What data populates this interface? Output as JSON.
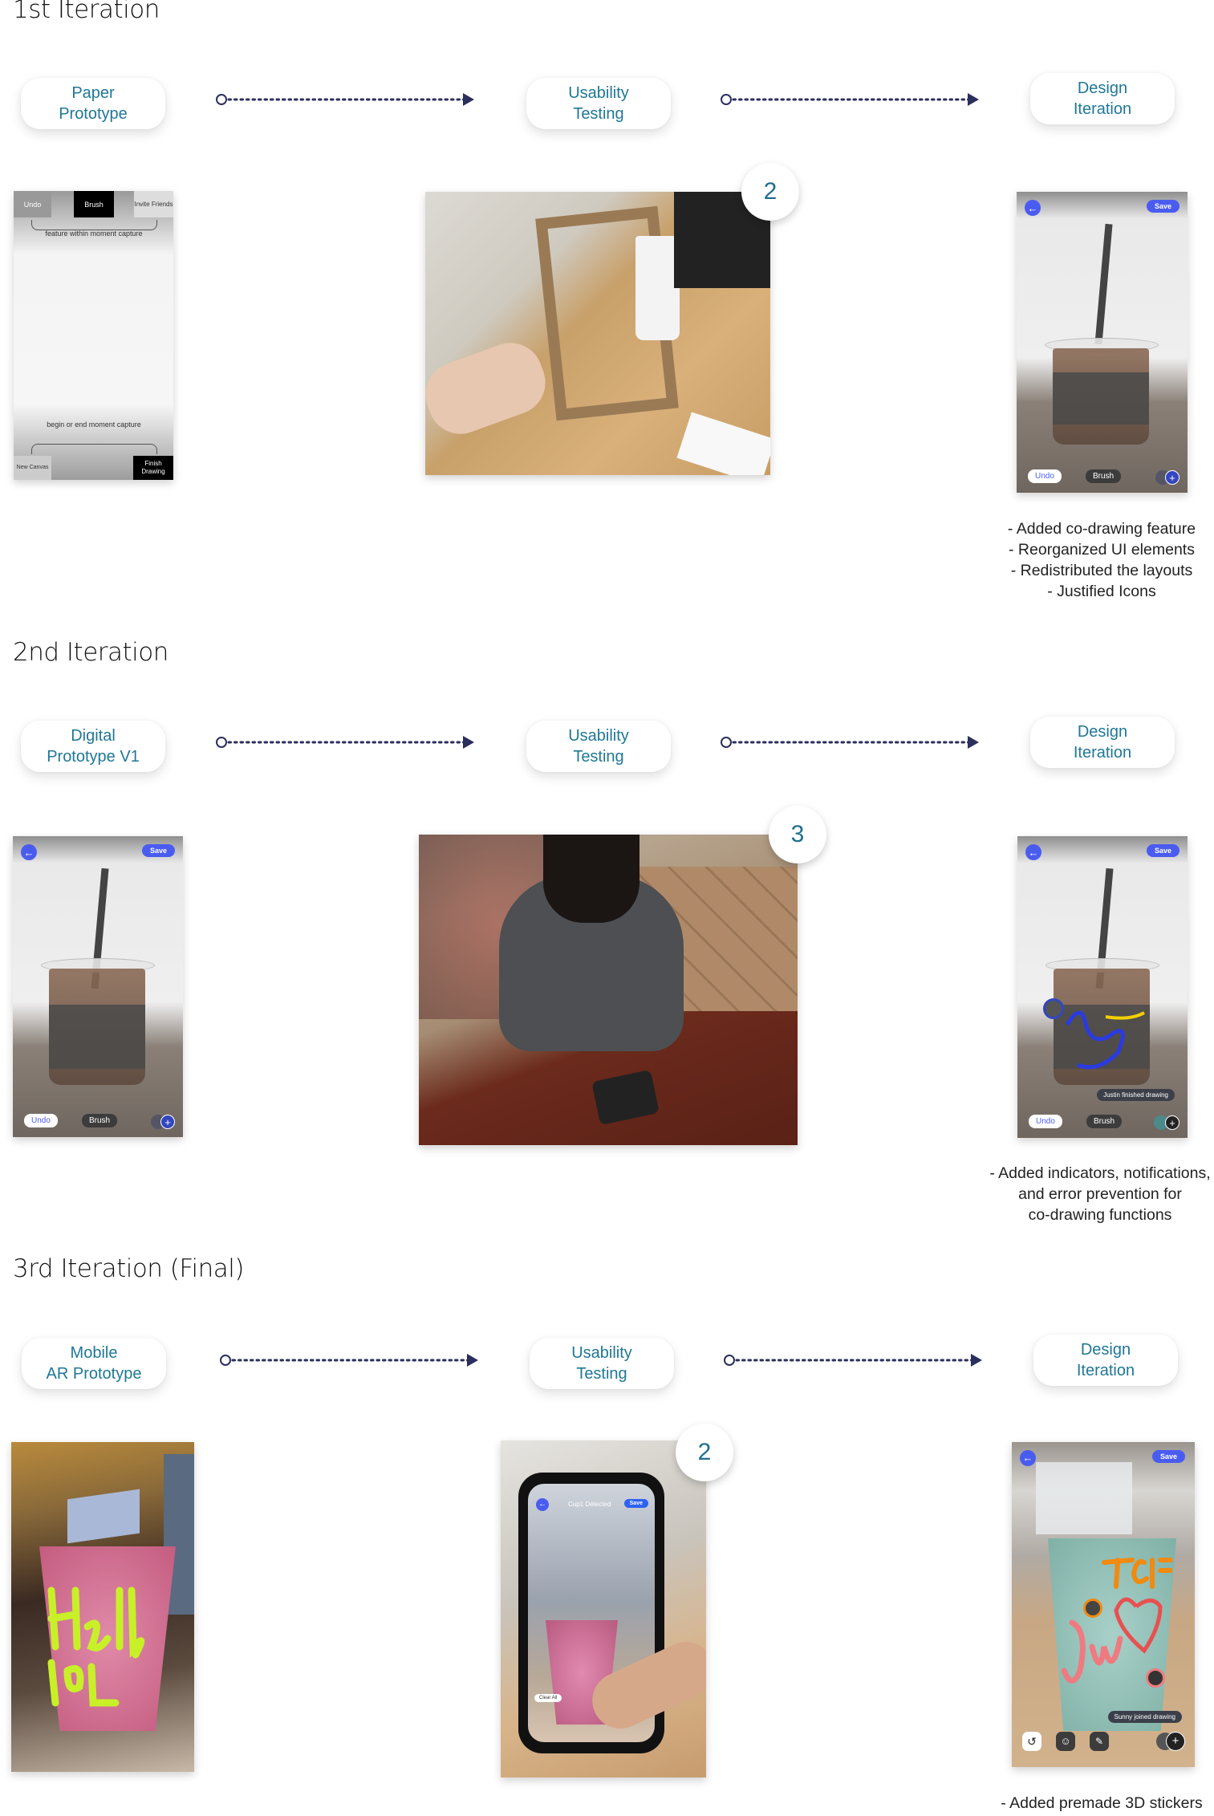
{
  "colors": {
    "pill_text": "#1f7796",
    "arrow": "#2b2f5e",
    "accent_blue": "#4a5cf0"
  },
  "iterations": [
    {
      "title": "1st Iteration",
      "steps": [
        {
          "line1": "Paper",
          "line2": "Prototype"
        },
        {
          "line1": "Usability",
          "line2": "Testing"
        },
        {
          "line1": "Design",
          "line2": "Iteration"
        }
      ],
      "paper_prototype": {
        "undo": "Undo",
        "brush": "Brush",
        "invite": "Invite Friends",
        "top_note": "feature within moment capture",
        "bottom_note": "begin or end moment capture",
        "new_canvas": "New Canvas",
        "finish": "Finish Drawing"
      },
      "testing_badge": "2",
      "design_app": {
        "save": "Save",
        "undo": "Undo",
        "brush": "Brush"
      },
      "notes": [
        "- Added co-drawing feature",
        "- Reorganized UI elements",
        "- Redistributed the layouts",
        "- Justified Icons"
      ]
    },
    {
      "title": "2nd Iteration",
      "steps": [
        {
          "line1": "Digital",
          "line2": "Prototype V1"
        },
        {
          "line1": "Usability",
          "line2": "Testing"
        },
        {
          "line1": "Design",
          "line2": "Iteration"
        }
      ],
      "prototype_app": {
        "save": "Save",
        "undo": "Undo",
        "brush": "Brush"
      },
      "testing_badge": "3",
      "design_app": {
        "save": "Save",
        "undo": "Undo",
        "brush": "Brush",
        "toast": "Justin finished drawing"
      },
      "notes": [
        "- Added indicators, notifications,",
        "and error prevention for",
        "co-drawing functions"
      ]
    },
    {
      "title": "3rd Iteration (Final)",
      "steps": [
        {
          "line1": "Mobile",
          "line2": "AR Prototype"
        },
        {
          "line1": "Usability",
          "line2": "Testing"
        },
        {
          "line1": "Design",
          "line2": "Iteration"
        }
      ],
      "testing_badge": "2",
      "testing_app": {
        "header": "Cup1 Detected",
        "save": "Save",
        "clear": "Clear All"
      },
      "design_app": {
        "save": "Save",
        "toast": "Sunny joined drawing"
      },
      "notes": [
        "- Added premade 3D stickers"
      ]
    }
  ]
}
